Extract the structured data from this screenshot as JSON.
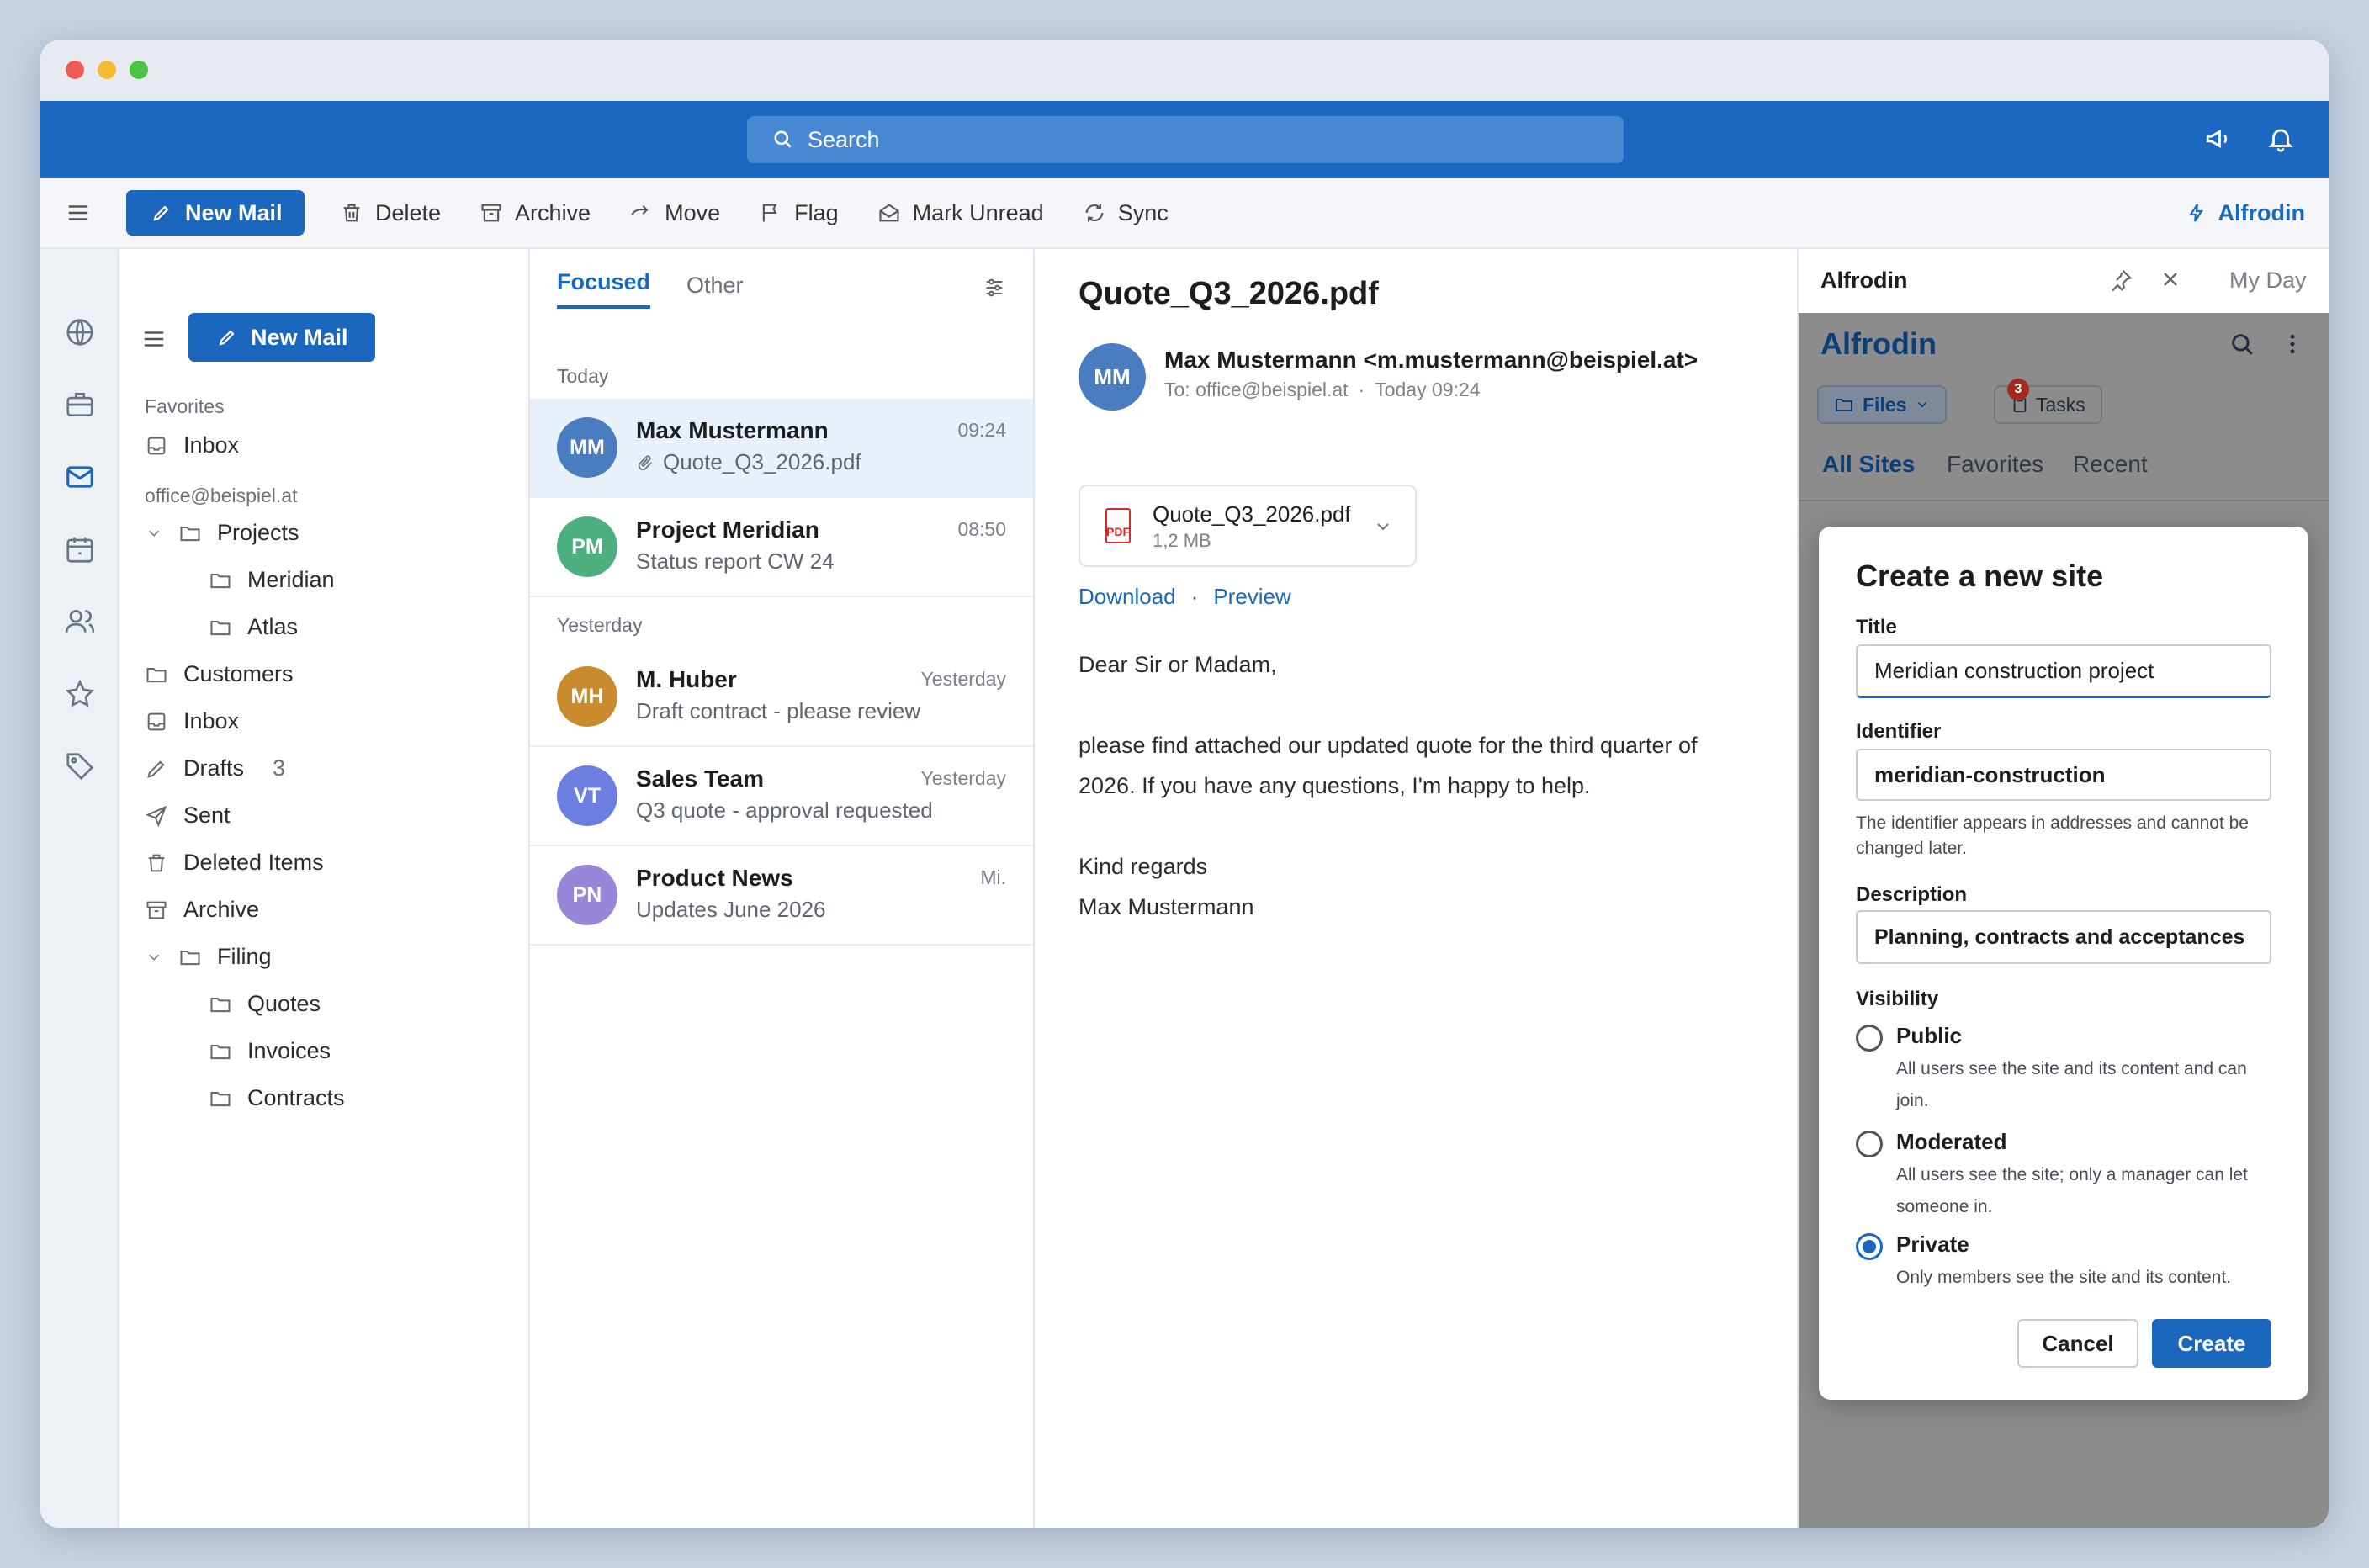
{
  "topbar": {
    "search_placeholder": "Search"
  },
  "toolbar": {
    "new_mail": "New Mail",
    "delete": "Delete",
    "archive": "Archive",
    "move": "Move",
    "flag": "Flag",
    "mark_unread": "Mark Unread",
    "sync": "Sync",
    "alfrodin": "Alfrodin"
  },
  "folders": {
    "new_mail": "New Mail",
    "favorites_header": "Favorites",
    "fav_inbox": "Inbox",
    "account": "office@beispiel.at",
    "projects": "Projects",
    "meridian": "Meridian",
    "atlas": "Atlas",
    "customers": "Customers",
    "inbox": "Inbox",
    "drafts": "Drafts",
    "drafts_count": "3",
    "sent": "Sent",
    "deleted": "Deleted Items",
    "archive": "Archive",
    "filing": "Filing",
    "quotes": "Quotes",
    "invoices": "Invoices",
    "contracts": "Contracts"
  },
  "list": {
    "tab_focused": "Focused",
    "tab_other": "Other",
    "group_today": "Today",
    "group_yesterday": "Yesterday",
    "mails": [
      {
        "initials": "MM",
        "name": "Max Mustermann",
        "subject": "Quote_Q3_2026.pdf",
        "time": "09:24",
        "color": "#4a7cc0"
      },
      {
        "initials": "PM",
        "name": "Project Meridian",
        "subject": "Status report CW 24",
        "time": "08:50",
        "color": "#4caf7d"
      },
      {
        "initials": "MH",
        "name": "M. Huber",
        "subject": "Draft contract - please review",
        "time": "Yesterday",
        "color": "#c98b2e"
      },
      {
        "initials": "VT",
        "name": "Sales Team",
        "subject": "Q3 quote - approval requested",
        "time": "Yesterday",
        "color": "#6c7ee0"
      },
      {
        "initials": "PN",
        "name": "Product News",
        "subject": "Updates June 2026",
        "time": "Mi.",
        "color": "#9a86d8"
      }
    ]
  },
  "reader": {
    "title": "Quote_Q3_2026.pdf",
    "sender_initials": "MM",
    "sender": "Max Mustermann <m.mustermann@beispiel.at>",
    "to": "To: office@beispiel.at",
    "date": "Today 09:24",
    "attachment_name": "Quote_Q3_2026.pdf",
    "attachment_size": "1,2 MB",
    "pdf_badge": "PDF",
    "download": "Download",
    "preview": "Preview",
    "greeting": "Dear Sir or Madam,",
    "body_line1": "please find attached our updated quote for the third quarter of",
    "body_line2": "2026. If you have any questions, I'm happy to help.",
    "regards": "Kind regards",
    "signature": "Max Mustermann"
  },
  "panel": {
    "header_title": "Alfrodin",
    "my_day": "My Day",
    "app_title": "Alfrodin",
    "files_button": "Files",
    "tasks_button": "Tasks",
    "tasks_badge": "3",
    "tab_all": "All Sites",
    "tab_favorites": "Favorites",
    "tab_recent": "Recent"
  },
  "dialog": {
    "title": "Create a new site",
    "title_label": "Title",
    "title_value": "Meridian construction project",
    "identifier_label": "Identifier",
    "identifier_value": "meridian-construction",
    "identifier_hint": "The identifier appears in addresses and cannot be changed later.",
    "description_label": "Description",
    "description_value": "Planning, contracts and acceptances",
    "visibility_label": "Visibility",
    "options": [
      {
        "title": "Public",
        "desc": "All users see the site and its content and can join.",
        "selected": false
      },
      {
        "title": "Moderated",
        "desc": "All users see the site; only a manager can let someone in.",
        "selected": false
      },
      {
        "title": "Private",
        "desc": "Only members see the site and its content.",
        "selected": true
      }
    ],
    "cancel": "Cancel",
    "create": "Create"
  },
  "colors": {
    "accent": "#1a67bd",
    "topbar": "#1c68c0",
    "selected_row": "#e8f0fa"
  }
}
